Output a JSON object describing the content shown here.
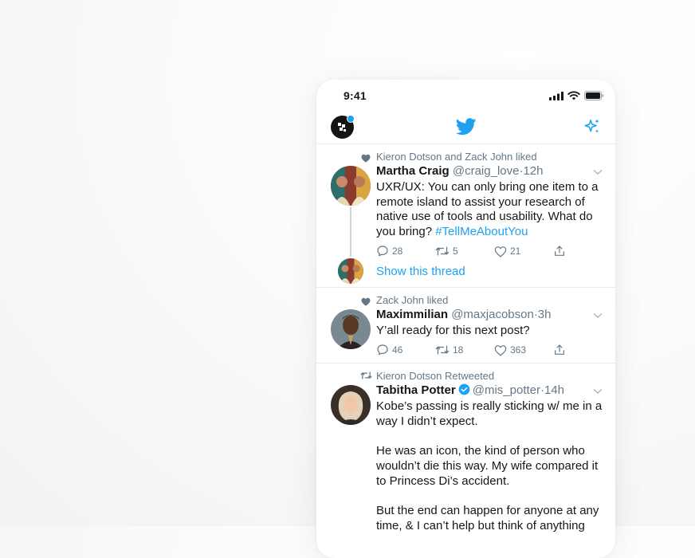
{
  "status_bar": {
    "time": "9:41"
  },
  "tweets": [
    {
      "context": "Kieron Dotson and Zack John liked",
      "name": "Martha Craig",
      "handle": "@craig_love",
      "time": "·12h",
      "text": "UXR/UX: You can only bring one item to a remote island to assist your research of native use of tools and usability. What do you bring? ",
      "hashtag": "#TellMeAboutYou",
      "replies": "28",
      "retweets": "5",
      "likes": "21",
      "show_thread": "Show this thread"
    },
    {
      "context": "Zack John liked",
      "name": "Maximmilian",
      "handle": "@maxjacobson",
      "time": "·3h",
      "text": "Y’all ready for this next post?",
      "replies": "46",
      "retweets": "18",
      "likes": "363"
    },
    {
      "context": "Kieron Dotson Retweeted",
      "name": "Tabitha Potter",
      "handle": "@mis_potter",
      "time": "·14h",
      "text": "Kobe’s passing is really sticking w/ me in a way I didn’t expect.\n\nHe was an icon, the kind of person who wouldn’t die this way. My wife compared it to Princess Di’s accident.\n\nBut the end can happen for anyone at any time, & I can’t help but think of anything"
    }
  ],
  "colors": {
    "accent": "#1da1f2",
    "text": "#14171a",
    "secondary_text": "#657786",
    "divider": "#e6ecf0"
  },
  "icons": [
    "twitter-bird-icon",
    "sparkle-icon",
    "heart-icon",
    "retweet-icon",
    "reply-icon",
    "share-icon",
    "chevron-down-icon",
    "verified-badge-icon"
  ]
}
